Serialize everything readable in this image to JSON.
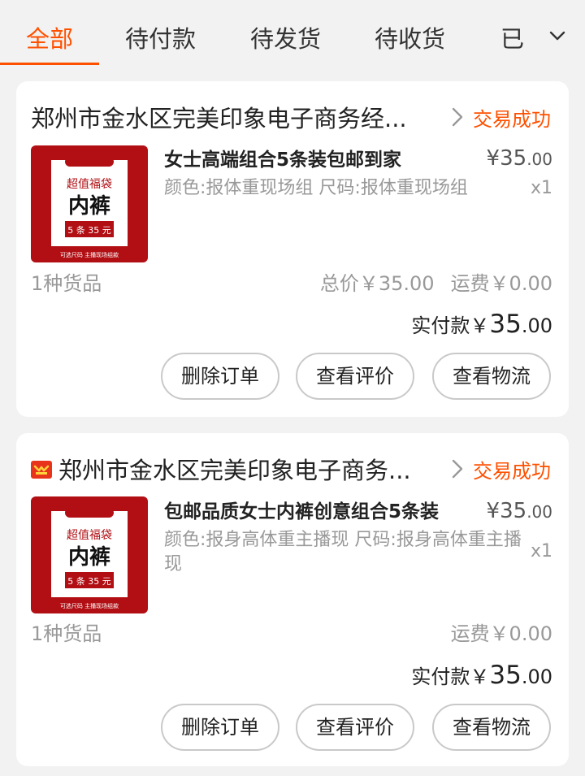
{
  "tabs": [
    {
      "label": "全部",
      "active": true
    },
    {
      "label": "待付款",
      "active": false
    },
    {
      "label": "待发货",
      "active": false
    },
    {
      "label": "待收货",
      "active": false
    },
    {
      "label": "已评价",
      "active": false
    }
  ],
  "tabs_more_icon": "chevron-down-icon",
  "colors": {
    "accent": "#ff5000",
    "product_red": "#b10f14"
  },
  "orders": [
    {
      "shop_icon": "",
      "shop_name": "郑州市金水区完美印象电子商务经...",
      "status": "交易成功",
      "product": {
        "title": "女士高端组合5条装包邮到家",
        "price_int": "¥35",
        "price_dec": ".00",
        "sku": "颜色:报体重现场组 尺码:报体重现场组",
        "qty": "x1",
        "thumb": {
          "line1": "超值福袋",
          "line2": "内裤",
          "line3": "5 条 35 元",
          "footer": "可选尺码  主播现场组款"
        }
      },
      "kinds": "1种货品",
      "total": "总价￥35.00",
      "shipping": "运费￥0.00",
      "paid_label": "实付款",
      "paid_currency": "￥",
      "paid_int": "35",
      "paid_dec": ".00",
      "buttons": [
        "删除订单",
        "查看评价",
        "查看物流"
      ]
    },
    {
      "shop_icon": "tmall-shop-icon",
      "shop_name": "郑州市金水区完美印象电子商务...",
      "status": "交易成功",
      "product": {
        "title": "包邮品质女士内裤创意组合5条装",
        "price_int": "¥35",
        "price_dec": ".00",
        "sku": "颜色:报身高体重主播现 尺码:报身高体重主播现",
        "qty": "x1",
        "thumb": {
          "line1": "超值福袋",
          "line2": "内裤",
          "line3": "5 条 35 元",
          "footer": "可选尺码  主播现场组款"
        }
      },
      "kinds": "1种货品",
      "shipping": "运费￥0.00",
      "paid_label": "实付款",
      "paid_currency": "￥",
      "paid_int": "35",
      "paid_dec": ".00",
      "buttons": [
        "删除订单",
        "查看评价",
        "查看物流"
      ]
    }
  ]
}
